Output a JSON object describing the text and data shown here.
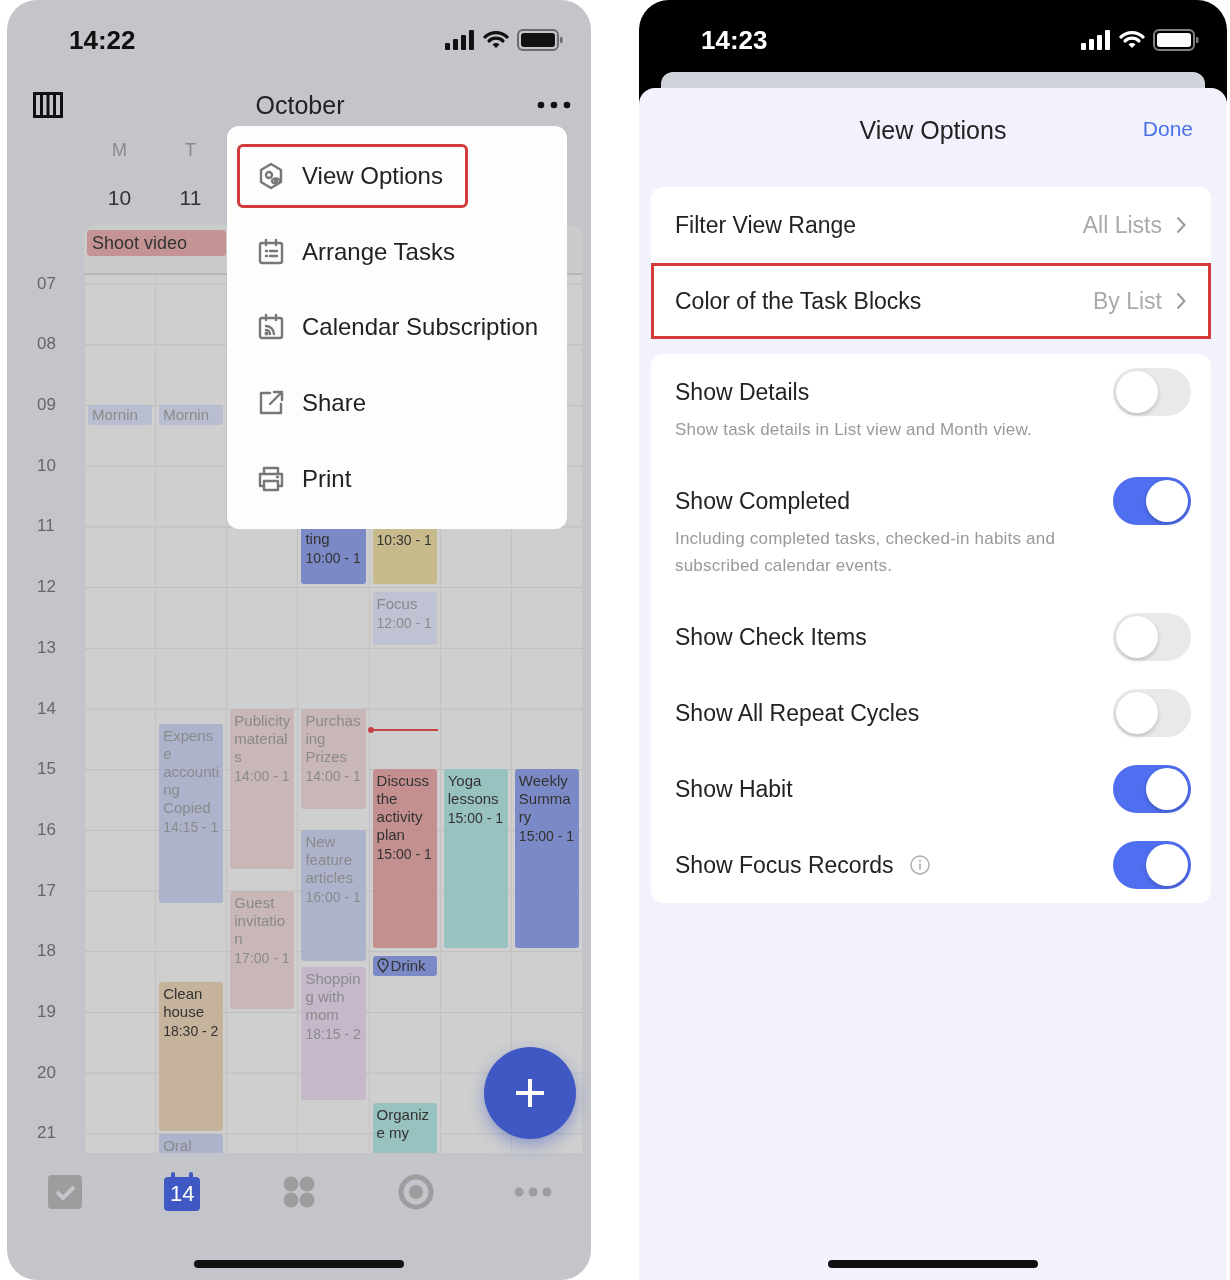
{
  "left_phone": {
    "status_bar": {
      "time": "14:22"
    },
    "header": {
      "month": "October"
    },
    "week_days": [
      {
        "day": "M",
        "date": "10"
      },
      {
        "day": "T",
        "date": "11"
      }
    ],
    "all_day_events": [
      {
        "title": "Shoot video",
        "color": "#c49393"
      }
    ],
    "hours": [
      "07",
      "08",
      "09",
      "10",
      "11",
      "12",
      "13",
      "14",
      "15",
      "16",
      "17",
      "18",
      "19",
      "20",
      "21"
    ],
    "day_columns": [
      {
        "events": [
          {
            "kind": "chip",
            "title": "Mornin",
            "color": "#b9bdd0",
            "dimmed": true
          }
        ]
      },
      {
        "events": [
          {
            "kind": "chip",
            "title": "Mornin",
            "color": "#b9bdd0",
            "dimmed": true
          },
          {
            "kind": "block",
            "title": "Expense accounting Copied",
            "time": "14:15 - 1",
            "color": "#aeb3cc",
            "dimmed": true
          },
          {
            "kind": "block",
            "title": "Clean house",
            "time": "18:30 - 2",
            "color": "#c6b39c",
            "dimmed": false
          },
          {
            "kind": "block",
            "title": "Oral",
            "color": "#aeb3cc",
            "dimmed": true
          }
        ]
      },
      {
        "events": [
          {
            "kind": "block",
            "title": "Publicity materials",
            "time": "14:00 - 1",
            "color": "#c9b6b6",
            "dimmed": true
          },
          {
            "kind": "block",
            "title": "Guest invitation",
            "time": "17:00 - 1",
            "color": "#c9b6b6",
            "dimmed": true
          }
        ]
      },
      {
        "events": [
          {
            "kind": "block",
            "title": "ting",
            "time": "10:00 - 1",
            "color": "#7b8ac6",
            "dimmed": false
          },
          {
            "kind": "block",
            "title": "Purchasing Prizes",
            "time": "14:00 - 1",
            "color": "#c9b6b6",
            "dimmed": true
          },
          {
            "kind": "block",
            "title": "New feature articles",
            "time": "16:00 - 1",
            "color": "#aeb3cc",
            "dimmed": true
          },
          {
            "kind": "block",
            "title": "Shopping with mom",
            "time": "18:15 - 2",
            "color": "#c6b8cb",
            "dimmed": true
          }
        ]
      },
      {
        "events": [
          {
            "kind": "block",
            "time": "10:30 - 1",
            "color": "#c8bb8b",
            "dimmed": false
          },
          {
            "kind": "block",
            "title": "Focus",
            "time": "12:00 - 1",
            "color": "#bfc2d3",
            "dimmed": true
          },
          {
            "kind": "block",
            "title": "Discuss the activity plan",
            "time": "15:00 - 1",
            "color": "#c38f8f",
            "dimmed": false
          },
          {
            "kind": "reminder",
            "title": "Drink",
            "color": "#7b8ac6",
            "dimmed": false
          },
          {
            "kind": "block",
            "title": "Organize my",
            "color": "#98c2bf",
            "dimmed": false
          }
        ]
      },
      {
        "events": [
          {
            "kind": "block",
            "title": "Yoga lessons",
            "time": "15:00 - 1",
            "color": "#98c2bf",
            "dimmed": false
          }
        ]
      },
      {
        "events": [
          {
            "kind": "block",
            "title": "Weekly Summary",
            "time": "15:00 - 1",
            "color": "#7b8ac6",
            "dimmed": false
          }
        ]
      }
    ],
    "menu": {
      "items": [
        {
          "label": "View Options",
          "highlighted": true
        },
        {
          "label": "Arrange Tasks",
          "highlighted": false
        },
        {
          "label": "Calendar Subscription",
          "highlighted": false
        },
        {
          "label": "Share",
          "highlighted": false
        },
        {
          "label": "Print",
          "highlighted": false
        }
      ]
    },
    "tab_bar": [
      {
        "selected": false
      },
      {
        "selected": true,
        "badge": "14"
      },
      {
        "selected": false
      },
      {
        "selected": false
      },
      {
        "selected": false
      }
    ]
  },
  "right_phone": {
    "status_bar": {
      "time": "14:23"
    },
    "sheet": {
      "title": "View Options",
      "done": "Done"
    },
    "nav_rows": [
      {
        "label": "Filter View Range",
        "value": "All Lists",
        "highlighted": false
      },
      {
        "label": "Color of the Task Blocks",
        "value": "By List",
        "highlighted": true
      }
    ],
    "settings": [
      {
        "label": "Show Details",
        "description": "Show task details in List view and Month view.",
        "on": false
      },
      {
        "label": "Show Completed",
        "description": "Including completed tasks, checked-in habits and subscribed calendar events.",
        "on": true
      },
      {
        "label": "Show Check Items",
        "on": false
      },
      {
        "label": "Show All Repeat Cycles",
        "on": false
      },
      {
        "label": "Show Habit",
        "on": true
      },
      {
        "label": "Show Focus Records",
        "on": true,
        "info": true
      }
    ]
  }
}
